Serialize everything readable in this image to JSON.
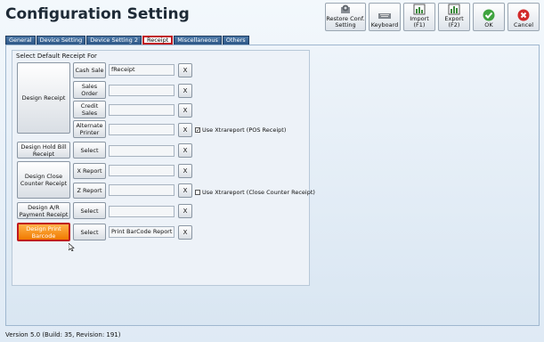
{
  "title": "Configuration Setting",
  "toolbar": [
    {
      "name": "restore-conf-setting-button",
      "icon": "restore-icon",
      "label": "Restore Conf.\nSetting"
    },
    {
      "name": "keyboard-button",
      "icon": "keyboard-icon",
      "label": "Keyboard"
    },
    {
      "name": "import-button",
      "icon": "import-icon",
      "label": "Import\n(F1)"
    },
    {
      "name": "export-button",
      "icon": "export-icon",
      "label": "Export\n(F2)"
    },
    {
      "name": "ok-button",
      "icon": "check-icon",
      "label": "OK"
    },
    {
      "name": "cancel-button",
      "icon": "close-icon",
      "label": "Cancel"
    }
  ],
  "tabs": [
    "General",
    "Device Setting",
    "Device Setting 2",
    "Receipt",
    "Miscellaneous",
    "Others"
  ],
  "active_tab": "Receipt",
  "group_label": "Select Default Receipt For",
  "buttons": {
    "design_receipt": "Design Receipt",
    "cash_sale": "Cash Sale",
    "sales_order": "Sales\nOrder",
    "credit_sales": "Credit\nSales",
    "alternate_printer": "Alternate\nPrinter",
    "design_hold_bill": "Design Hold Bill\nReceipt",
    "select": "Select",
    "design_close_counter": "Design Close\nCounter Receipt",
    "x_report": "X Report",
    "z_report": "Z Report",
    "design_ar_payment": "Design A/R\nPayment Receipt",
    "design_print_barcode": "Design Print\nBarcode",
    "x": "X"
  },
  "fields": {
    "cash_sale": "fReceipt",
    "sales_order": "",
    "credit_sales": "",
    "alternate_printer": "",
    "hold_bill": "",
    "x_report": "",
    "z_report": "",
    "ar_payment": "",
    "print_barcode": "Print BarCode Report (:"
  },
  "checkboxes": {
    "xtrareport_pos": {
      "label": "Use Xtrareport (POS Receipt)",
      "checked": true
    },
    "xtrareport_close": {
      "label": "Use Xtrareport (Close Counter Receipt)",
      "checked": false
    }
  },
  "version": "Version 5.0 (Build: 35, Revision: 191)",
  "colors": {
    "highlight": "#c0181f",
    "accent_orange": "#f07a00",
    "tab_blue": "#2b5585"
  }
}
